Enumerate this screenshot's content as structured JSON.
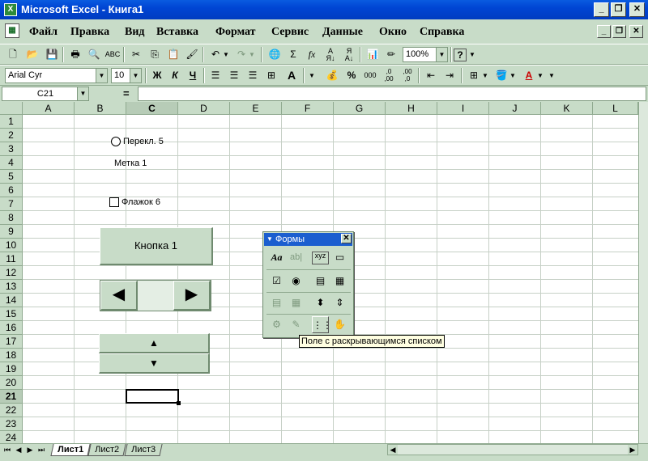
{
  "window": {
    "title": "Microsoft Excel - Книга1",
    "app_icon": "X"
  },
  "menu": [
    "Файл",
    "Правка",
    "Вид",
    "Вставка",
    "Формат",
    "Сервис",
    "Данные",
    "Окно",
    "Справка"
  ],
  "toolbar": {
    "zoom": "100%",
    "font": "Arial Cyr",
    "size": "10",
    "bold": "Ж",
    "italic": "К",
    "underline": "Ч"
  },
  "formula_bar": {
    "cell_ref": "C21",
    "eq": "="
  },
  "columns": [
    "A",
    "B",
    "C",
    "D",
    "E",
    "F",
    "G",
    "H",
    "I",
    "J",
    "K",
    "L"
  ],
  "rows": [
    "1",
    "2",
    "3",
    "4",
    "5",
    "6",
    "7",
    "8",
    "9",
    "10",
    "11",
    "12",
    "13",
    "14",
    "15",
    "16",
    "17",
    "18",
    "19",
    "20",
    "21",
    "22",
    "23",
    "24"
  ],
  "controls": {
    "radio_label": "Перекл. 5",
    "label": "Метка 1",
    "checkbox_label": "Флажок 6",
    "button_label": "Кнопка 1"
  },
  "forms_toolbar": {
    "title": "Формы",
    "tooltip": "Поле с раскрывающимся списком"
  },
  "sheets": [
    "Лист1",
    "Лист2",
    "Лист3"
  ],
  "colors": {
    "title_bar": "#0a5be0",
    "chrome": "#c8dcc8"
  }
}
